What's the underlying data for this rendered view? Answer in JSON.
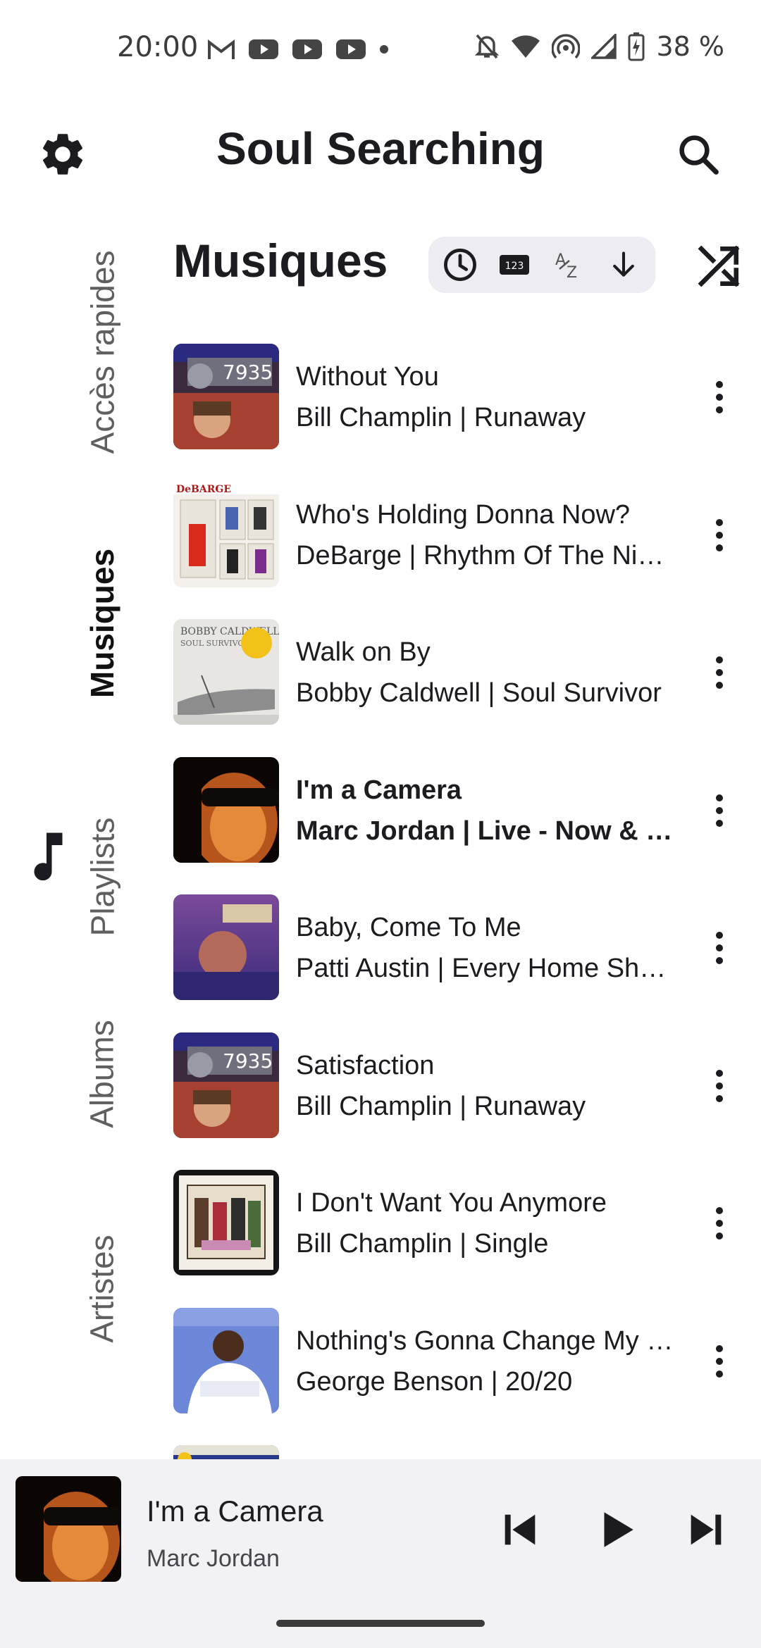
{
  "status_bar": {
    "time": "20:00",
    "notification_icons": [
      "gmail-icon",
      "youtube-icon",
      "youtube-icon",
      "youtube-icon",
      "dot-icon"
    ],
    "system_icons": [
      "bell-off-icon",
      "wifi-icon",
      "hotspot-icon",
      "signal-icon",
      "battery-charging-icon"
    ],
    "battery": "38 %"
  },
  "app_bar": {
    "title": "Soul Searching",
    "settings_icon": "gear-icon",
    "search_icon": "search-icon"
  },
  "side_nav": {
    "items": [
      {
        "label": "Accès rapides",
        "active": false
      },
      {
        "label": "Musiques",
        "active": true
      },
      {
        "label": "Playlists",
        "active": false
      },
      {
        "label": "Albums",
        "active": false
      },
      {
        "label": "Artistes",
        "active": false
      }
    ],
    "active_icon": "music-note-icon"
  },
  "section": {
    "title": "Musiques",
    "sort_icons": [
      "clock-icon",
      "numeric-sort-icon",
      "alpha-sort-icon",
      "arrow-down-icon"
    ],
    "shuffle_icon": "shuffle-icon"
  },
  "tracks": [
    {
      "title": "Without You",
      "subtitle": "Bill Champlin | Runaway",
      "current": false
    },
    {
      "title": "Who's Holding Donna Now?",
      "subtitle": "DeBarge | Rhythm Of The Ni…",
      "current": false
    },
    {
      "title": "Walk on By",
      "subtitle": "Bobby Caldwell | Soul Survivor",
      "current": false
    },
    {
      "title": "I'm a Camera",
      "subtitle": "Marc Jordan | Live - Now & …",
      "current": true
    },
    {
      "title": "Baby, Come To Me",
      "subtitle": "Patti Austin | Every Home Sh…",
      "current": false
    },
    {
      "title": "Satisfaction",
      "subtitle": "Bill Champlin | Runaway",
      "current": false
    },
    {
      "title": "I Don't Want You Anymore",
      "subtitle": "Bill Champlin | Single",
      "current": false
    },
    {
      "title": "Nothing's Gonna Change My …",
      "subtitle": "George Benson | 20/20",
      "current": false
    },
    {
      "title": "",
      "subtitle": "",
      "current": false
    }
  ],
  "player": {
    "title": "I'm a Camera",
    "artist": "Marc Jordan",
    "controls": [
      "skip-previous-icon",
      "play-icon",
      "skip-next-icon"
    ]
  },
  "colors": {
    "background": "#ffffff",
    "text": "#1c1b1f",
    "player_background": "#f2f2f5",
    "sort_pill": "#ececf2"
  }
}
